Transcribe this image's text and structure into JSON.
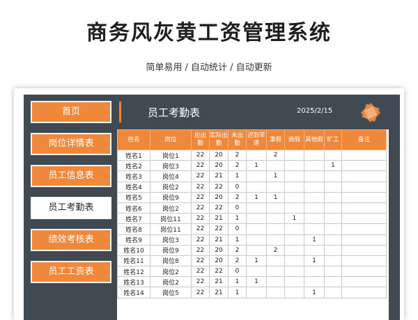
{
  "header": {
    "title": "商务风灰黄工资管理系统",
    "subtitle": "简单易用 / 自动统计 / 自动更新"
  },
  "nav": [
    {
      "label": "首页",
      "active": false
    },
    {
      "label": "岗位详情表",
      "active": false
    },
    {
      "label": "员工信息表",
      "active": false
    },
    {
      "label": "员工考勤表",
      "active": true
    },
    {
      "label": "绩效考核表",
      "active": false
    },
    {
      "label": "员工工资表",
      "active": false
    }
  ],
  "panel": {
    "title": "员工考勤表",
    "date": "2025/2/15"
  },
  "colors": {
    "accent": "#f0883c",
    "frame": "#3f4a53"
  },
  "table": {
    "columns": [
      "姓名",
      "岗位",
      "应出勤",
      "实际出勤",
      "未出勤",
      "迟到早退",
      "事假",
      "病假",
      "其他假",
      "旷工",
      "备注"
    ],
    "rows": [
      [
        "姓名1",
        "岗位1",
        "22",
        "20",
        "2",
        "",
        "2",
        "",
        "",
        "",
        ""
      ],
      [
        "姓名2",
        "岗位3",
        "22",
        "20",
        "2",
        "1",
        "",
        "",
        "",
        "1",
        ""
      ],
      [
        "姓名3",
        "岗位4",
        "22",
        "21",
        "1",
        "",
        "1",
        "",
        "",
        "",
        ""
      ],
      [
        "姓名4",
        "岗位2",
        "22",
        "22",
        "0",
        "",
        "",
        "",
        "",
        "",
        ""
      ],
      [
        "姓名5",
        "岗位9",
        "22",
        "20",
        "2",
        "1",
        "1",
        "",
        "",
        "",
        ""
      ],
      [
        "姓名6",
        "岗位2",
        "22",
        "22",
        "0",
        "",
        "",
        "",
        "",
        "",
        ""
      ],
      [
        "姓名7",
        "岗位11",
        "22",
        "21",
        "1",
        "",
        "",
        "1",
        "",
        "",
        ""
      ],
      [
        "姓名8",
        "岗位11",
        "22",
        "22",
        "0",
        "",
        "",
        "",
        "",
        "",
        ""
      ],
      [
        "姓名9",
        "岗位3",
        "22",
        "21",
        "1",
        "",
        "",
        "",
        "1",
        "",
        ""
      ],
      [
        "姓名10",
        "岗位9",
        "22",
        "20",
        "2",
        "",
        "2",
        "",
        "",
        "",
        ""
      ],
      [
        "姓名11",
        "岗位8",
        "22",
        "20",
        "2",
        "1",
        "",
        "",
        "1",
        "",
        ""
      ],
      [
        "姓名12",
        "岗位2",
        "22",
        "22",
        "0",
        "",
        "",
        "",
        "",
        "",
        ""
      ],
      [
        "姓名13",
        "岗位2",
        "22",
        "21",
        "1",
        "1",
        "",
        "",
        "",
        "",
        ""
      ],
      [
        "姓名14",
        "岗位5",
        "22",
        "21",
        "1",
        "",
        "",
        "",
        "1",
        "",
        ""
      ]
    ]
  }
}
